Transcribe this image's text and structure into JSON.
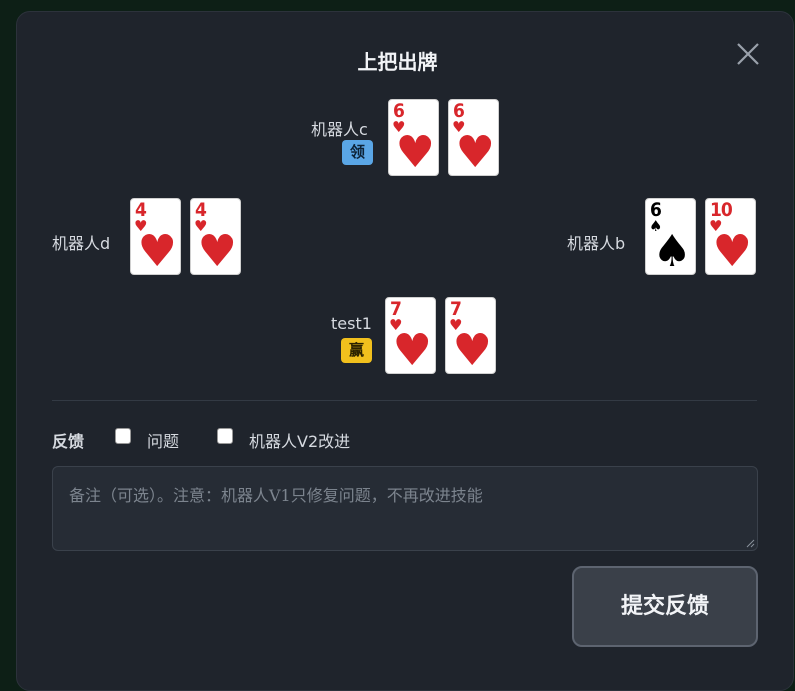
{
  "dialog": {
    "title": "上把出牌",
    "close_icon": "close-icon"
  },
  "players": {
    "top": {
      "name": "机器人c",
      "badge": "领",
      "cards": [
        {
          "rank": "6",
          "suit": "♥",
          "color": "red"
        },
        {
          "rank": "6",
          "suit": "♥",
          "color": "red"
        }
      ]
    },
    "left": {
      "name": "机器人d",
      "cards": [
        {
          "rank": "4",
          "suit": "♥",
          "color": "red"
        },
        {
          "rank": "4",
          "suit": "♥",
          "color": "red"
        }
      ]
    },
    "right": {
      "name": "机器人b",
      "cards": [
        {
          "rank": "6",
          "suit": "♠",
          "color": "black"
        },
        {
          "rank": "10",
          "suit": "♥",
          "color": "red"
        }
      ]
    },
    "bottom": {
      "name": "test1",
      "badge": "赢",
      "cards": [
        {
          "rank": "7",
          "suit": "♥",
          "color": "red"
        },
        {
          "rank": "7",
          "suit": "♥",
          "color": "red"
        }
      ]
    }
  },
  "feedback": {
    "label": "反馈",
    "options": [
      {
        "label": "问题",
        "checked": false
      },
      {
        "label": "机器人V2改进",
        "checked": false
      }
    ],
    "note_placeholder": "备注（可选）。注意：机器人V1只修复问题，不再改进技能",
    "submit_label": "提交反馈"
  },
  "colors": {
    "lead_badge": "#5aa6e6",
    "win_badge": "#f1c01d",
    "heart_red": "#d8262b"
  }
}
